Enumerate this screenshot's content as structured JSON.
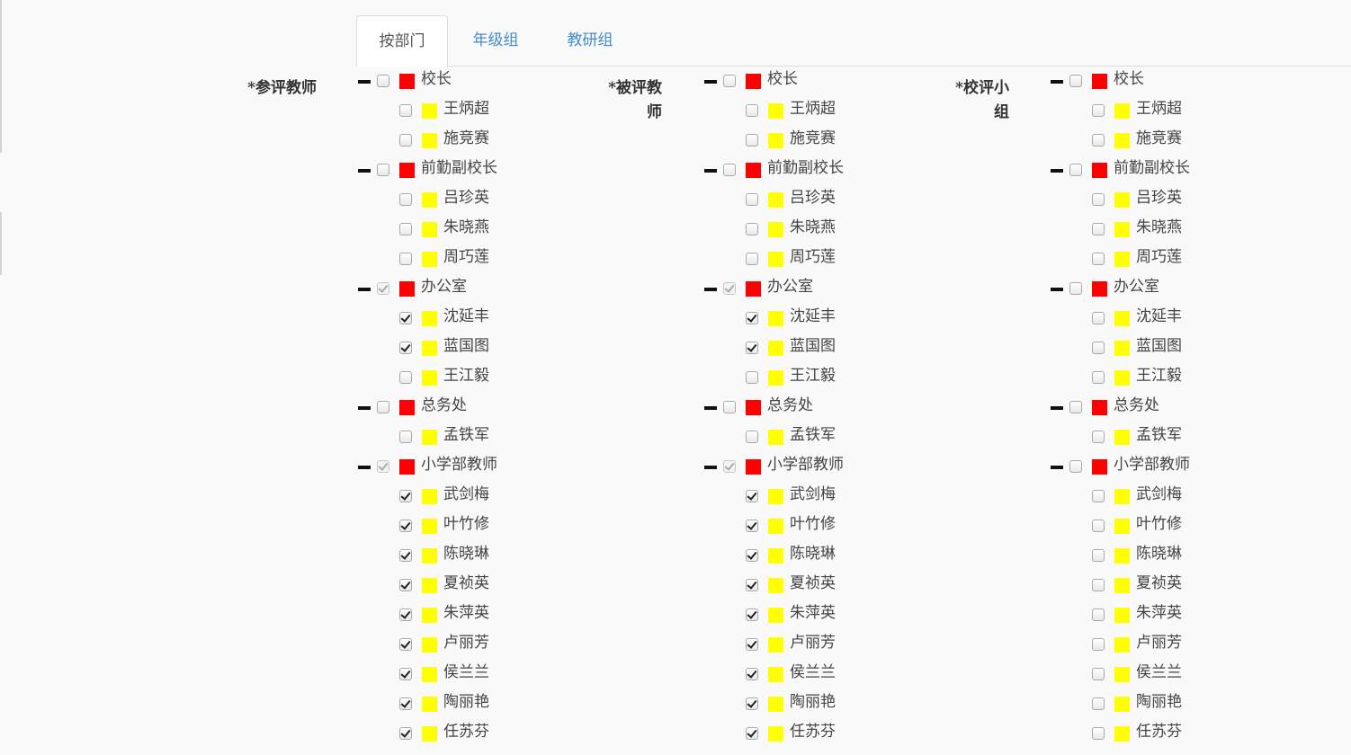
{
  "tabs": [
    {
      "label": "按部门",
      "active": true
    },
    {
      "label": "年级组",
      "active": false
    },
    {
      "label": "教研组",
      "active": false
    }
  ],
  "colors": {
    "dept": "#ff0000",
    "person": "#ffff00",
    "tab_link": "#428bca"
  },
  "sections": [
    {
      "label": "*参评教师",
      "rows": [
        {
          "level": 0,
          "name": "校长",
          "checked": false
        },
        {
          "level": 1,
          "name": "王炳超",
          "checked": false
        },
        {
          "level": 1,
          "name": "施竞赛",
          "checked": false
        },
        {
          "level": 0,
          "name": "前勤副校长",
          "checked": false
        },
        {
          "level": 1,
          "name": "吕珍英",
          "checked": false
        },
        {
          "level": 1,
          "name": "朱晓燕",
          "checked": false
        },
        {
          "level": 1,
          "name": "周巧莲",
          "checked": false
        },
        {
          "level": 0,
          "name": "办公室",
          "checked": true,
          "disabled": true
        },
        {
          "level": 1,
          "name": "沈延丰",
          "checked": true
        },
        {
          "level": 1,
          "name": "蓝国图",
          "checked": true
        },
        {
          "level": 1,
          "name": "王江毅",
          "checked": false
        },
        {
          "level": 0,
          "name": "总务处",
          "checked": false
        },
        {
          "level": 1,
          "name": "孟铁军",
          "checked": false
        },
        {
          "level": 0,
          "name": "小学部教师",
          "checked": true,
          "disabled": true
        },
        {
          "level": 1,
          "name": "武剑梅",
          "checked": true
        },
        {
          "level": 1,
          "name": "叶竹修",
          "checked": true
        },
        {
          "level": 1,
          "name": "陈晓琳",
          "checked": true
        },
        {
          "level": 1,
          "name": "夏祯英",
          "checked": true
        },
        {
          "level": 1,
          "name": "朱萍英",
          "checked": true
        },
        {
          "level": 1,
          "name": "卢丽芳",
          "checked": true
        },
        {
          "level": 1,
          "name": "侯兰兰",
          "checked": true
        },
        {
          "level": 1,
          "name": "陶丽艳",
          "checked": true
        },
        {
          "level": 1,
          "name": "任苏芬",
          "checked": true
        }
      ]
    },
    {
      "label": "*被评教师",
      "rows": [
        {
          "level": 0,
          "name": "校长",
          "checked": false
        },
        {
          "level": 1,
          "name": "王炳超",
          "checked": false
        },
        {
          "level": 1,
          "name": "施竞赛",
          "checked": false
        },
        {
          "level": 0,
          "name": "前勤副校长",
          "checked": false
        },
        {
          "level": 1,
          "name": "吕珍英",
          "checked": false
        },
        {
          "level": 1,
          "name": "朱晓燕",
          "checked": false
        },
        {
          "level": 1,
          "name": "周巧莲",
          "checked": false
        },
        {
          "level": 0,
          "name": "办公室",
          "checked": true,
          "disabled": true
        },
        {
          "level": 1,
          "name": "沈延丰",
          "checked": true
        },
        {
          "level": 1,
          "name": "蓝国图",
          "checked": true
        },
        {
          "level": 1,
          "name": "王江毅",
          "checked": false
        },
        {
          "level": 0,
          "name": "总务处",
          "checked": false
        },
        {
          "level": 1,
          "name": "孟铁军",
          "checked": false
        },
        {
          "level": 0,
          "name": "小学部教师",
          "checked": true,
          "disabled": true
        },
        {
          "level": 1,
          "name": "武剑梅",
          "checked": true
        },
        {
          "level": 1,
          "name": "叶竹修",
          "checked": true
        },
        {
          "level": 1,
          "name": "陈晓琳",
          "checked": true
        },
        {
          "level": 1,
          "name": "夏祯英",
          "checked": true
        },
        {
          "level": 1,
          "name": "朱萍英",
          "checked": true
        },
        {
          "level": 1,
          "name": "卢丽芳",
          "checked": true
        },
        {
          "level": 1,
          "name": "侯兰兰",
          "checked": true
        },
        {
          "level": 1,
          "name": "陶丽艳",
          "checked": true
        },
        {
          "level": 1,
          "name": "任苏芬",
          "checked": true
        }
      ]
    },
    {
      "label": "*校评小组",
      "rows": [
        {
          "level": 0,
          "name": "校长",
          "checked": false
        },
        {
          "level": 1,
          "name": "王炳超",
          "checked": false
        },
        {
          "level": 1,
          "name": "施竞赛",
          "checked": false
        },
        {
          "level": 0,
          "name": "前勤副校长",
          "checked": false
        },
        {
          "level": 1,
          "name": "吕珍英",
          "checked": false
        },
        {
          "level": 1,
          "name": "朱晓燕",
          "checked": false
        },
        {
          "level": 1,
          "name": "周巧莲",
          "checked": false
        },
        {
          "level": 0,
          "name": "办公室",
          "checked": false
        },
        {
          "level": 1,
          "name": "沈延丰",
          "checked": false
        },
        {
          "level": 1,
          "name": "蓝国图",
          "checked": false
        },
        {
          "level": 1,
          "name": "王江毅",
          "checked": false
        },
        {
          "level": 0,
          "name": "总务处",
          "checked": false
        },
        {
          "level": 1,
          "name": "孟铁军",
          "checked": false
        },
        {
          "level": 0,
          "name": "小学部教师",
          "checked": false
        },
        {
          "level": 1,
          "name": "武剑梅",
          "checked": false
        },
        {
          "level": 1,
          "name": "叶竹修",
          "checked": false
        },
        {
          "level": 1,
          "name": "陈晓琳",
          "checked": false
        },
        {
          "level": 1,
          "name": "夏祯英",
          "checked": false
        },
        {
          "level": 1,
          "name": "朱萍英",
          "checked": false
        },
        {
          "level": 1,
          "name": "卢丽芳",
          "checked": false
        },
        {
          "level": 1,
          "name": "侯兰兰",
          "checked": false
        },
        {
          "level": 1,
          "name": "陶丽艳",
          "checked": false
        },
        {
          "level": 1,
          "name": "任苏芬",
          "checked": false
        }
      ]
    }
  ]
}
